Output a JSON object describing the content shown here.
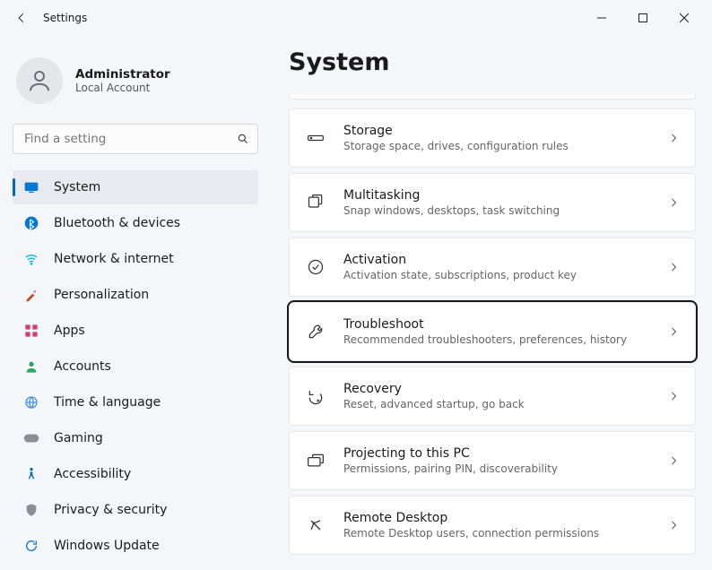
{
  "window": {
    "title": "Settings"
  },
  "user": {
    "name": "Administrator",
    "sub": "Local Account"
  },
  "search": {
    "placeholder": "Find a setting"
  },
  "nav": [
    {
      "label": "System",
      "icon": "monitor",
      "color": "#0078d4",
      "active": true
    },
    {
      "label": "Bluetooth & devices",
      "icon": "bt",
      "color": "#0078d4"
    },
    {
      "label": "Network & internet",
      "icon": "wifi",
      "color": "#00b0ff"
    },
    {
      "label": "Personalization",
      "icon": "brush",
      "color": "#c04b2a"
    },
    {
      "label": "Apps",
      "icon": "apps",
      "color": "#d83b6f"
    },
    {
      "label": "Accounts",
      "icon": "person",
      "color": "#2aa85f"
    },
    {
      "label": "Time & language",
      "icon": "globe",
      "color": "#4a90d9"
    },
    {
      "label": "Gaming",
      "icon": "game",
      "color": "#8a8f97"
    },
    {
      "label": "Accessibility",
      "icon": "access",
      "color": "#0067c0"
    },
    {
      "label": "Privacy & security",
      "icon": "shield",
      "color": "#8a8f97"
    },
    {
      "label": "Windows Update",
      "icon": "update",
      "color": "#0078d4"
    }
  ],
  "page": {
    "title": "System"
  },
  "cards": [
    {
      "title": "Storage",
      "sub": "Storage space, drives, configuration rules",
      "icon": "storage"
    },
    {
      "title": "Multitasking",
      "sub": "Snap windows, desktops, task switching",
      "icon": "multitask"
    },
    {
      "title": "Activation",
      "sub": "Activation state, subscriptions, product key",
      "icon": "check"
    },
    {
      "title": "Troubleshoot",
      "sub": "Recommended troubleshooters, preferences, history",
      "icon": "wrench",
      "focused": true
    },
    {
      "title": "Recovery",
      "sub": "Reset, advanced startup, go back",
      "icon": "recovery"
    },
    {
      "title": "Projecting to this PC",
      "sub": "Permissions, pairing PIN, discoverability",
      "icon": "project"
    },
    {
      "title": "Remote Desktop",
      "sub": "Remote Desktop users, connection permissions",
      "icon": "remote"
    }
  ]
}
